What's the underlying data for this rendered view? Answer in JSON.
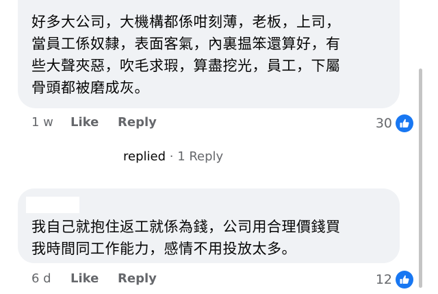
{
  "comments": [
    {
      "author": "",
      "lines": [
        "好多大公司，大機構都係咁刻薄，老板，上司，",
        "當員工係奴隸，表面客氣，內裏揾笨還算好，有",
        "些大聲夾惡，吹毛求瑕，算盡挖光，員工，下屬",
        "骨頭都被磨成灰。"
      ],
      "time": "1 w",
      "like_label": "Like",
      "reply_label": "Reply",
      "reaction_count": "30",
      "reaction_icon": "thumbs-up-icon",
      "replies": {
        "replied_label": "replied",
        "separator": " · ",
        "count_label": "1 Reply"
      }
    },
    {
      "author": "",
      "lines": [
        "我自己就抱住返工就係為錢，公司用合理價錢買",
        "我時間同工作能力，感情不用投放太多。"
      ],
      "time": "6 d",
      "like_label": "Like",
      "reply_label": "Reply",
      "reaction_count": "12",
      "reaction_icon": "thumbs-up-icon"
    }
  ],
  "colors": {
    "bubble": "#f0f2f5",
    "meta_text": "#65676b",
    "reaction_blue": "#1877f2"
  }
}
